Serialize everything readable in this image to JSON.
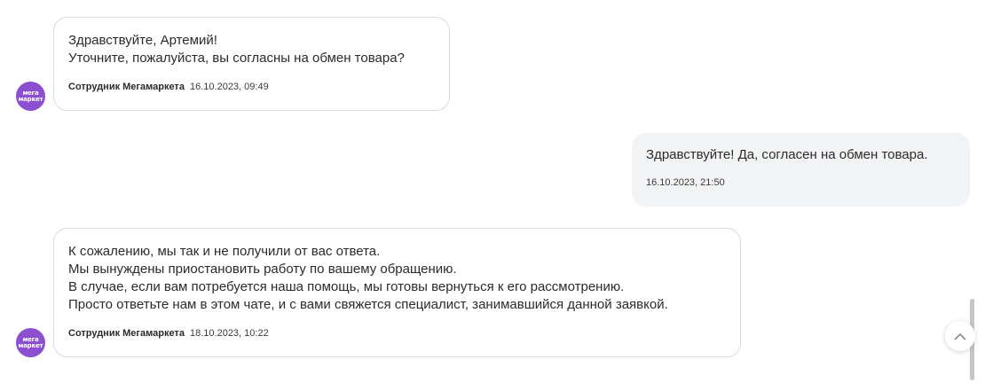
{
  "messages": [
    {
      "direction": "in",
      "avatar": {
        "line1": "мега",
        "line2": "маркет"
      },
      "lines": [
        "Здравствуйте, Артемий!",
        "Уточните, пожалуйста, вы согласны на обмен товара?"
      ],
      "author": "Сотрудник Мегамаркета",
      "time": "16.10.2023, 09:49"
    },
    {
      "direction": "out",
      "lines": [
        "Здравствуйте! Да, согласен на обмен товара."
      ],
      "time": "16.10.2023, 21:50"
    },
    {
      "direction": "in",
      "avatar": {
        "line1": "мега",
        "line2": "маркет"
      },
      "lines": [
        "К сожалению, мы так и не получили от вас ответа.",
        "Мы вынуждены приостановить работу по вашему обращению.",
        "В случае, если вам потребуется наша помощь, мы готовы вернуться к его рассмотрению.",
        "Просто ответьте нам в этом чате, и с вами свяжется специалист, занимавшийся данной заявкой."
      ],
      "author": "Сотрудник Мегамаркета",
      "time": "18.10.2023, 10:22"
    }
  ],
  "controls": {
    "scroll_top_icon": "chevron-up-icon"
  },
  "colors": {
    "avatar_bg": "#8b4fcf",
    "outgoing_bg": "#f1f3f5",
    "incoming_border": "#d9dadd"
  }
}
